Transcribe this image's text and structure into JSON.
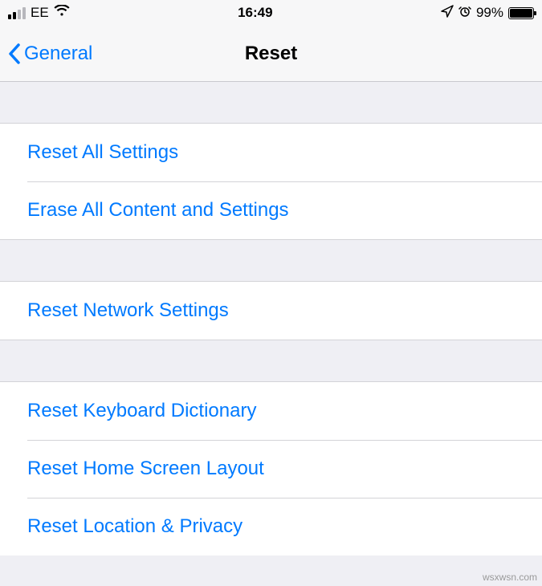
{
  "status_bar": {
    "carrier": "EE",
    "time": "16:49",
    "battery_percent": "99%"
  },
  "nav": {
    "back_label": "General",
    "title": "Reset"
  },
  "sections": {
    "group1": {
      "item0": "Reset All Settings",
      "item1": "Erase All Content and Settings"
    },
    "group2": {
      "item0": "Reset Network Settings"
    },
    "group3": {
      "item0": "Reset Keyboard Dictionary",
      "item1": "Reset Home Screen Layout",
      "item2": "Reset Location & Privacy"
    }
  },
  "watermark": "wsxwsn.com"
}
